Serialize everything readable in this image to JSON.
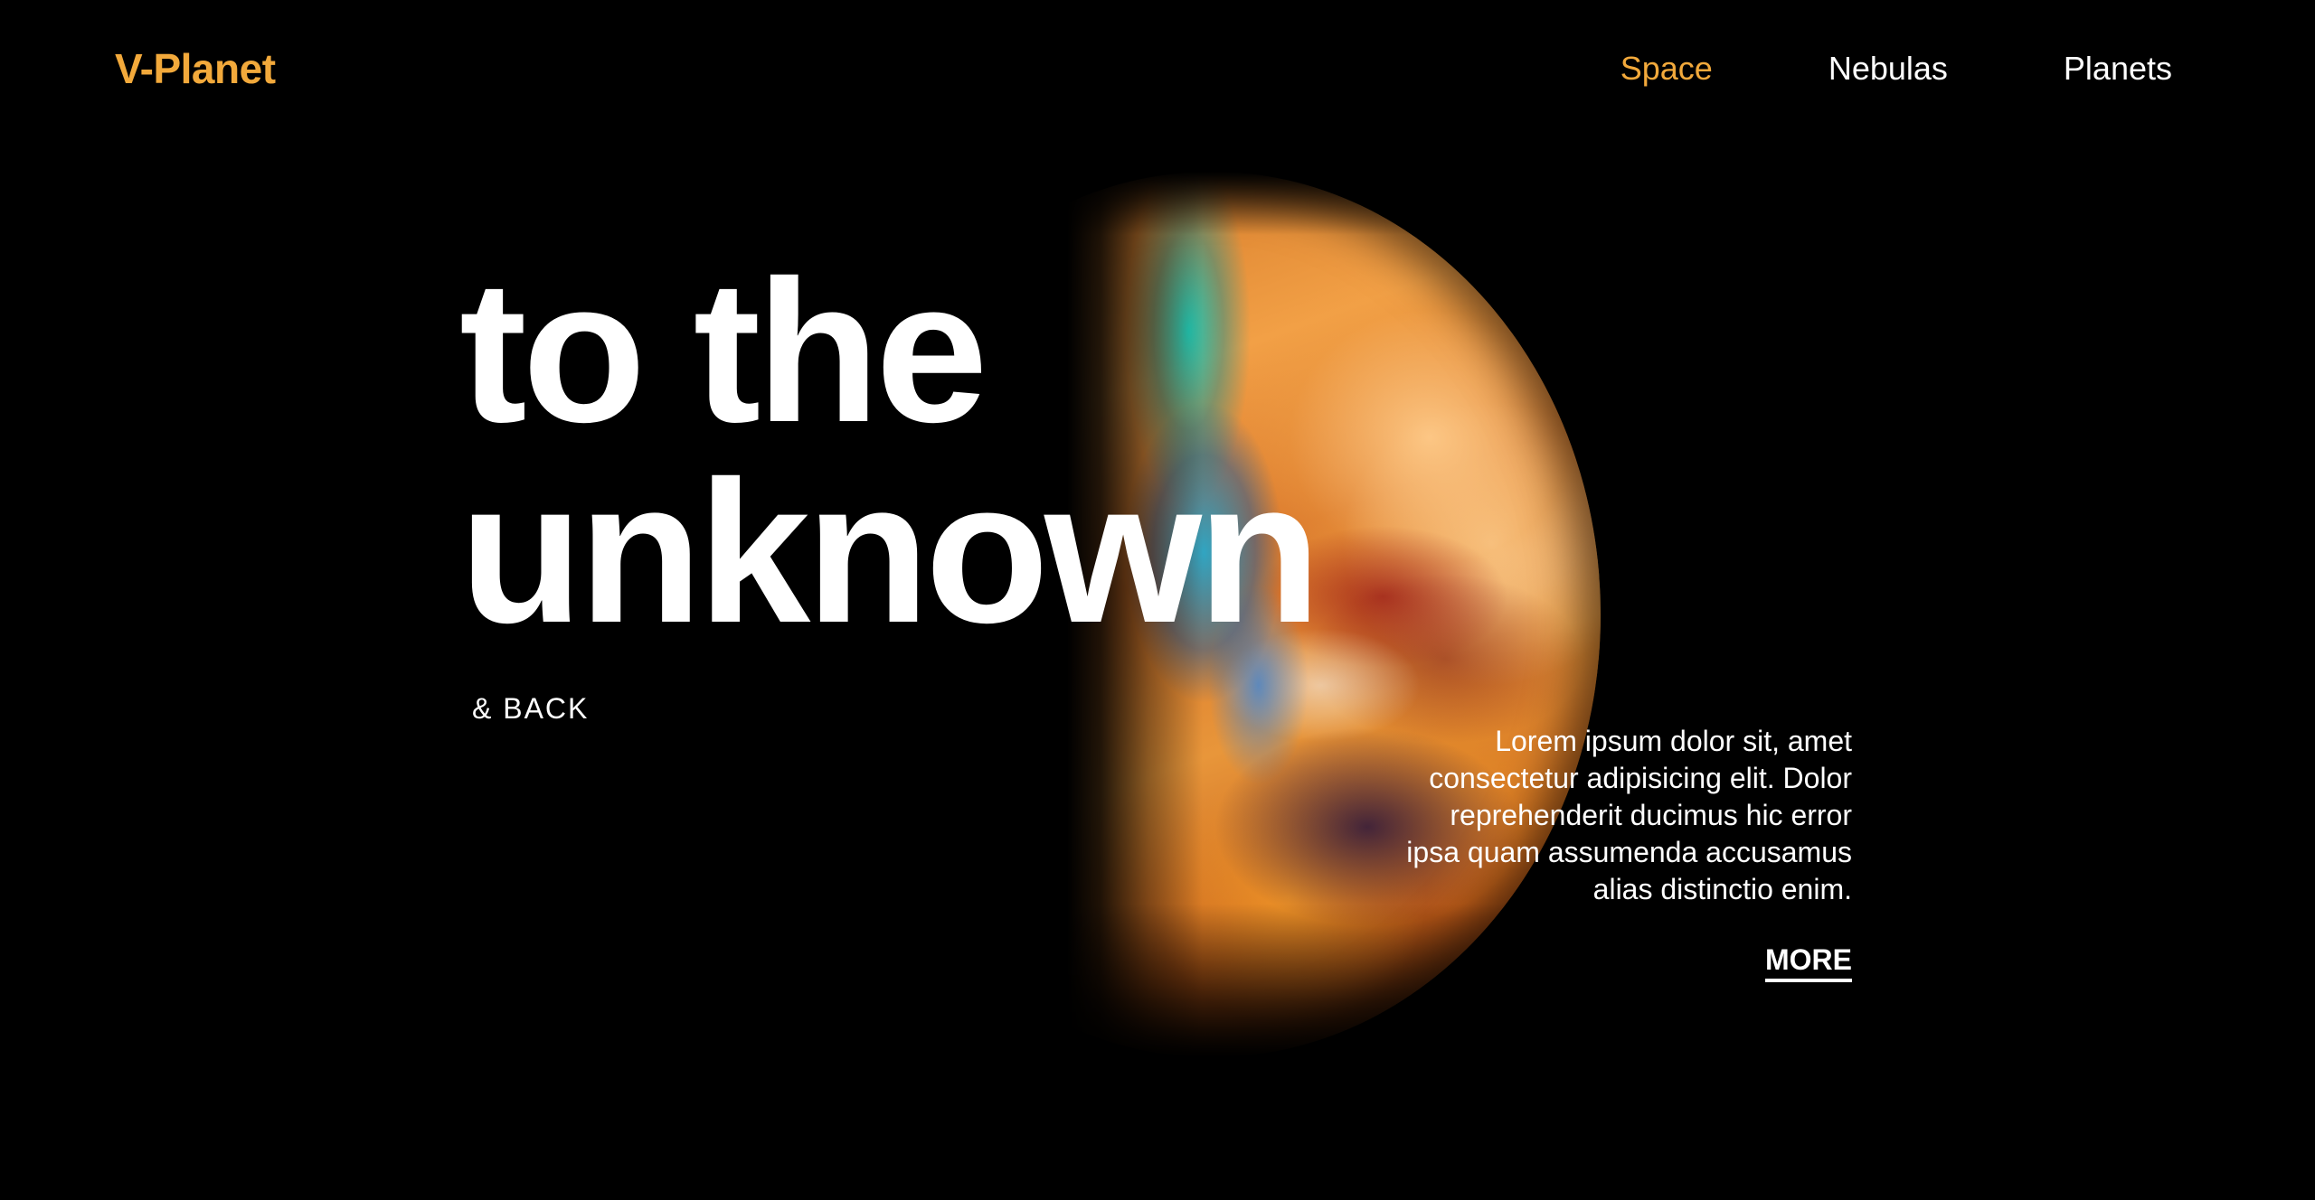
{
  "colors": {
    "background": "#000000",
    "accent": "#f2a93b",
    "text": "#ffffff"
  },
  "header": {
    "logo": "V-Planet",
    "nav": [
      {
        "label": "Space",
        "active": true
      },
      {
        "label": "Nebulas",
        "active": false
      },
      {
        "label": "Planets",
        "active": false
      }
    ]
  },
  "hero": {
    "line1": "to the",
    "line2": "unknown",
    "subtitle": "& BACK"
  },
  "content": {
    "description": "Lorem ipsum dolor sit, amet consectetur adipisicing elit. Dolor reprehenderit ducimus hic error ipsa quam assumenda accusamus alias distinctio enim.",
    "more_label": "MORE"
  },
  "art": {
    "icon": "planet-image"
  }
}
